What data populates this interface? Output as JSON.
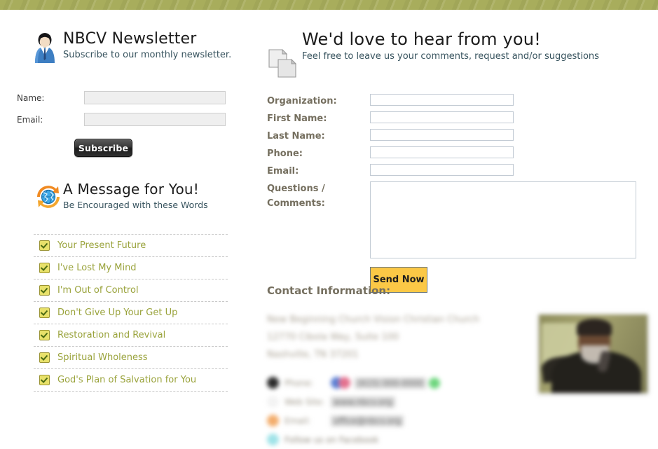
{
  "banner": {
    "color": "#a8ad5c"
  },
  "newsletter": {
    "icon": "businessman-avatar-icon",
    "title": "NBCV Newsletter",
    "subtitle": "Subscribe to our monthly newsletter.",
    "fields": [
      {
        "label": "Name:",
        "value": "",
        "placeholder": "",
        "name": "name"
      },
      {
        "label": "Email:",
        "value": "",
        "placeholder": "",
        "name": "email"
      }
    ],
    "submit_label": "Subscribe"
  },
  "message": {
    "icon": "globe-refresh-icon",
    "title": "A Message for You!",
    "subtitle": "Be Encouraged with these Words",
    "link_color": "#9aa33c",
    "items": [
      {
        "label": "Your Present Future"
      },
      {
        "label": "I've Lost My Mind"
      },
      {
        "label": "I'm Out of Control"
      },
      {
        "label": "Don't Give Up Your Get Up"
      },
      {
        "label": "Restoration and Revival"
      },
      {
        "label": "Spiritual Wholeness"
      },
      {
        "label": "God's Plan of Salvation for You"
      }
    ]
  },
  "contact_form": {
    "icon": "documents-icon",
    "title": "We'd love to hear from you!",
    "subtitle": "Feel free to leave us your comments, request and/or suggestions",
    "fields": [
      {
        "label": "Organization:",
        "value": "",
        "placeholder": "",
        "name": "organization"
      },
      {
        "label": "First Name:",
        "value": "",
        "placeholder": "",
        "name": "first-name"
      },
      {
        "label": "Last Name:",
        "value": "",
        "placeholder": "",
        "name": "last-name"
      },
      {
        "label": "Phone:",
        "value": "",
        "placeholder": "",
        "name": "phone"
      },
      {
        "label": "Email:",
        "value": "",
        "placeholder": "",
        "name": "email"
      }
    ],
    "comments_label": "Questions / Comments:",
    "comments_value": "",
    "submit_label": "Send Now",
    "submit_color": "#fbc846"
  },
  "contact_info": {
    "title": "Contact Information:",
    "address_lines": [
      "New Beginning Church Vision Christian Church",
      "12770 Cibola Way, Suite 100",
      "Nashville, TN 37201"
    ],
    "rows": [
      {
        "icon": "phone-icon",
        "key": "Phone:",
        "value": "(615) 000-0000",
        "name": "contact-phone"
      },
      {
        "icon": "fax-icon",
        "key": "Web Site:",
        "value": "www.nbcv.org",
        "name": "contact-website"
      },
      {
        "icon": "email-icon",
        "key": "Email:",
        "value": "office@nbcv.org",
        "name": "contact-email"
      },
      {
        "icon": "facebook-icon",
        "key": "Follow us on Facebook",
        "value": "",
        "name": "contact-facebook"
      }
    ]
  },
  "photo": {
    "alt": "pastor-photo"
  }
}
